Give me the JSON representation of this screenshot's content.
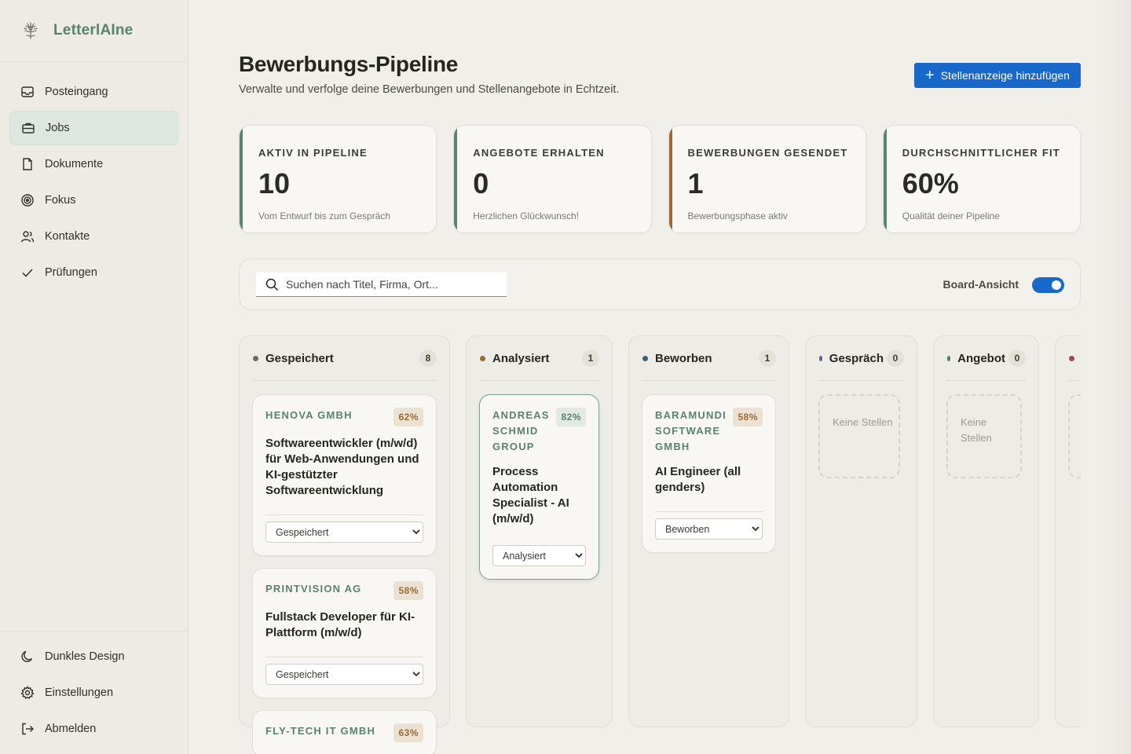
{
  "app": {
    "name": "LetterlAIne",
    "brand_color": "#5b8170",
    "accent_color": "#1868c9"
  },
  "sidebar": {
    "items": [
      {
        "label": "Posteingang",
        "icon": "inbox-icon",
        "active": false
      },
      {
        "label": "Jobs",
        "icon": "briefcase-icon",
        "active": true
      },
      {
        "label": "Dokumente",
        "icon": "document-icon",
        "active": false
      },
      {
        "label": "Fokus",
        "icon": "target-icon",
        "active": false
      },
      {
        "label": "Kontakte",
        "icon": "contacts-icon",
        "active": false
      },
      {
        "label": "Prüfungen",
        "icon": "checkmark-icon",
        "active": false
      }
    ],
    "bottom": [
      {
        "label": "Dunkles Design",
        "icon": "moon-icon"
      },
      {
        "label": "Einstellungen",
        "icon": "gear-icon"
      },
      {
        "label": "Abmelden",
        "icon": "logout-icon"
      }
    ]
  },
  "header": {
    "title": "Bewerbungs-Pipeline",
    "subtitle": "Verwalte und verfolge deine Bewerbungen und Stellenangebote in Echtzeit.",
    "add_button": "Stellenanzeige hinzufügen"
  },
  "stats": [
    {
      "label": "AKTIV IN PIPELINE",
      "value": "10",
      "hint": "Vom Entwurf bis zum Gespräch",
      "color": "#5b8170"
    },
    {
      "label": "ANGEBOTE ERHALTEN",
      "value": "0",
      "hint": "Herzlichen Glückwunsch!",
      "color": "#5b8170"
    },
    {
      "label": "BEWERBUNGEN GESENDET",
      "value": "1",
      "hint": "Bewerbungsphase aktiv",
      "color": "#9a6a35"
    },
    {
      "label": "DURCHSCHNITTLICHER FIT",
      "value": "60%",
      "hint": "Qualität deiner Pipeline",
      "color": "#5b8170"
    }
  ],
  "filter": {
    "search_placeholder": "Suchen nach Titel, Firma, Ort...",
    "toggle_label": "Board-Ansicht",
    "toggle_on": true
  },
  "columns": [
    {
      "name": "Gespeichert",
      "count": "8",
      "dot": "#6b6b64",
      "cards": [
        {
          "company": "HENOVA GMBH",
          "fit": "62%",
          "role": "Softwareentwickler (m/w/d) für Web-Anwendungen und KI-gestützter Softwareentwicklung",
          "status": "Gespeichert"
        },
        {
          "company": "PRINTVISION AG",
          "fit": "58%",
          "role": "Fullstack Developer für KI-Plattform (m/w/d)",
          "status": "Gespeichert"
        },
        {
          "company": "FLY-TECH IT GMBH",
          "fit": "63%"
        }
      ]
    },
    {
      "name": "Analysiert",
      "count": "1",
      "dot": "#9a6a35",
      "cards": [
        {
          "company": "ANDREAS SCHMID GROUP",
          "fit": "82%",
          "role": "Process Automation Specialist - AI (m/w/d)",
          "status": "Analysiert"
        }
      ]
    },
    {
      "name": "Beworben",
      "count": "1",
      "dot": "#3f6273",
      "cards": [
        {
          "company": "BARAMUNDI SOFTWARE GMBH",
          "fit": "58%",
          "role": "AI Engineer (all genders)",
          "status": "Beworben"
        }
      ]
    },
    {
      "name": "Gespräch",
      "count": "0",
      "dot": "#6a5a86",
      "empty": "Keine Stellen"
    },
    {
      "name": "Angebot",
      "count": "0",
      "dot": "#4f7a61",
      "empty": "Keine Stellen"
    },
    {
      "dot": "#9c4a44"
    }
  ],
  "status_options": [
    "Gespeichert",
    "Analysiert",
    "Beworben",
    "Gespräch",
    "Angebot"
  ]
}
